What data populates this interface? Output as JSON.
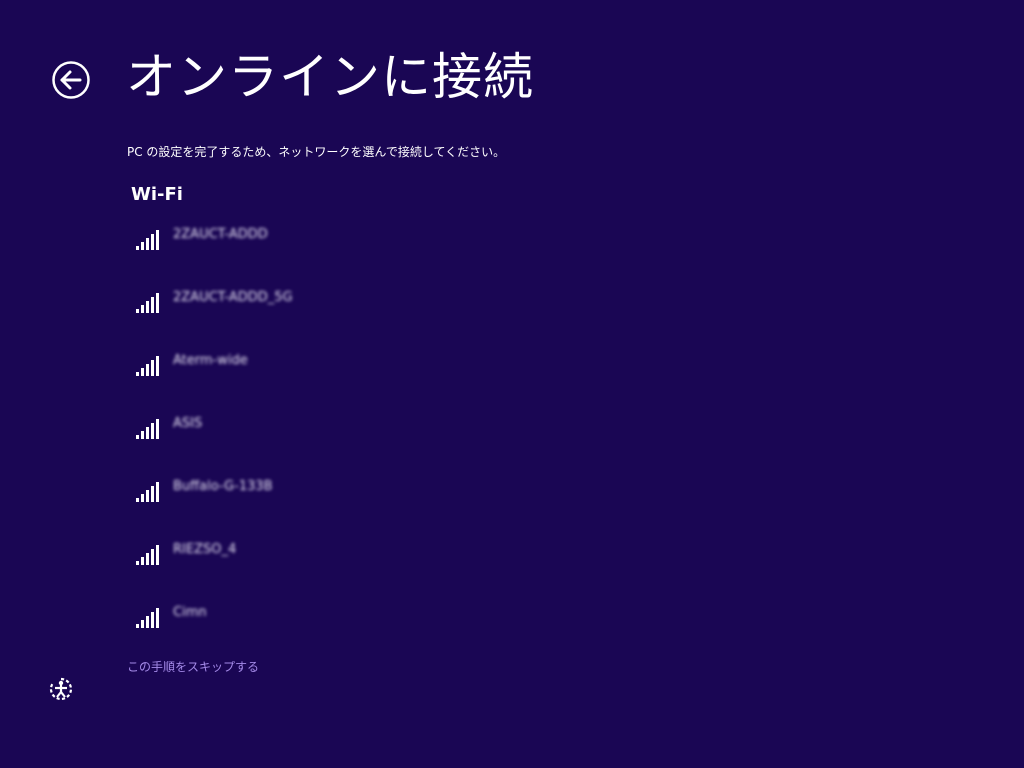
{
  "header": {
    "title": "オンラインに接続",
    "back_icon": "back-arrow-icon"
  },
  "instructions": "PC の設定を完了するため、ネットワークを選んで接続してください。",
  "wifi": {
    "heading": "Wi-Fi",
    "signal_icon": "wifi-signal-icon",
    "networks": [
      {
        "name": "2ZAUCT-ADDD"
      },
      {
        "name": "2ZAUCT-ADDD_5G"
      },
      {
        "name": "Aterm-wide"
      },
      {
        "name": "ASIS"
      },
      {
        "name": "Buffalo-G-133B"
      },
      {
        "name": "RIEZSO_4"
      },
      {
        "name": "Cimn"
      }
    ]
  },
  "footer": {
    "skip_label": "この手順をスキップする",
    "ease_of_access_icon": "ease-of-access-icon"
  },
  "colors": {
    "background": "#1a0654",
    "text": "#ffffff",
    "link": "#a48ae8"
  }
}
